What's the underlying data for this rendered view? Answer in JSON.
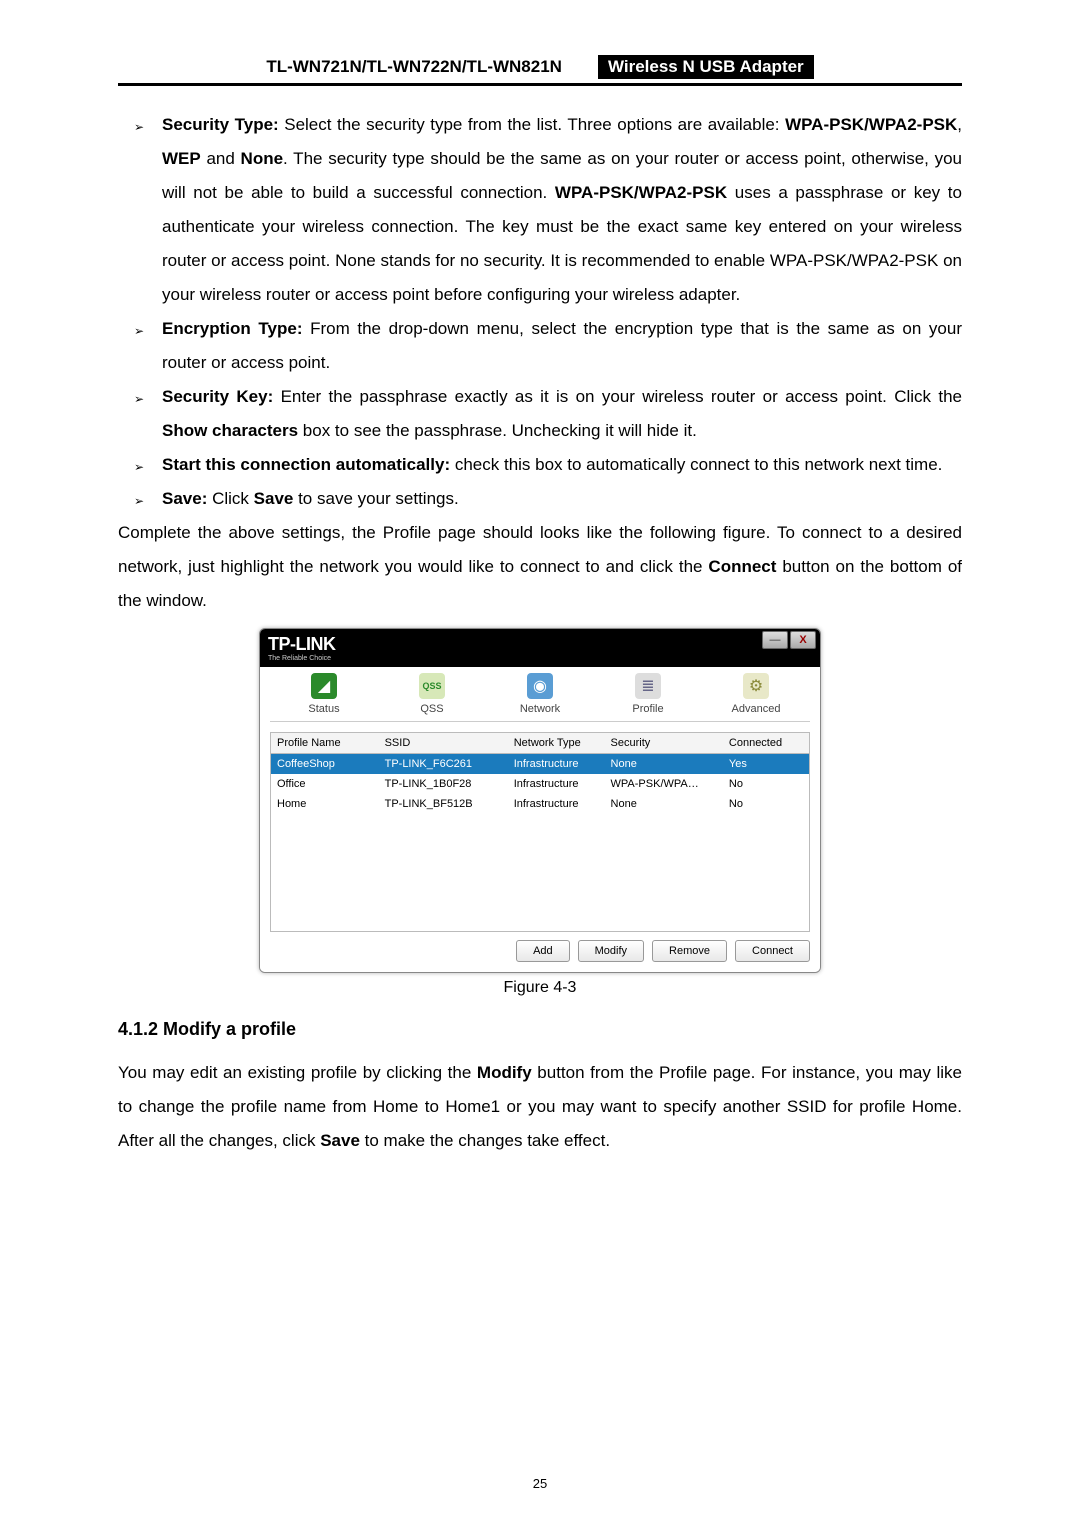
{
  "header": {
    "model": "TL-WN721N/TL-WN722N/TL-WN821N",
    "product": "Wireless N USB Adapter"
  },
  "bullets": {
    "security_type": {
      "label": "Security Type:",
      "text1": " Select the security type from the list. Three options are available: ",
      "bold1": "WPA-PSK/WPA2-PSK",
      "bold2": "WEP",
      "bold3": "None",
      "text2": ". The security type should be the same as on your router or access point, otherwise, you will not be able to build a successful connection. ",
      "bold4": "WPA-PSK/WPA2-PSK",
      "text3": " uses a passphrase or key to authenticate your wireless connection. The key must be the exact same key entered on your wireless router or access point. None stands for no security. It is recommended to enable WPA-PSK/WPA2-PSK on your wireless router or access point before configuring your wireless adapter."
    },
    "encryption_type": {
      "label": "Encryption Type:",
      "text": " From the drop-down menu, select the encryption type that is the same as on your router or access point."
    },
    "security_key": {
      "label": "Security Key:",
      "text1": " Enter the passphrase exactly as it is on your wireless router or access point. Click the ",
      "bold1": "Show characters",
      "text2": " box to see the passphrase. Unchecking it will hide it."
    },
    "start_conn": {
      "label": "Start this connection automatically:",
      "text": " check this box to automatically connect to this network next time."
    },
    "save": {
      "label": "Save:",
      "text1": " Click ",
      "bold1": "Save",
      "text2": " to save your settings."
    }
  },
  "paragraph1": {
    "text1": "Complete the above settings, the Profile page should looks like the following figure. To connect to a desired network, just highlight the network you would like to connect to and click the ",
    "bold1": "Connect",
    "text2": " button on the bottom of the window."
  },
  "app": {
    "logo": "TP-LINK",
    "logo_sub": "The Reliable Choice",
    "tabs": {
      "status": "Status",
      "qss": "QSS",
      "network": "Network",
      "profile": "Profile",
      "advanced": "Advanced"
    },
    "table": {
      "headers": {
        "name": "Profile Name",
        "ssid": "SSID",
        "type": "Network Type",
        "security": "Security",
        "connected": "Connected"
      },
      "rows": [
        {
          "name": "CoffeeShop",
          "ssid": "TP-LINK_F6C261",
          "type": "Infrastructure",
          "security": "None",
          "connected": "Yes",
          "selected": true
        },
        {
          "name": "Office",
          "ssid": "TP-LINK_1B0F28",
          "type": "Infrastructure",
          "security": "WPA-PSK/WPA…",
          "connected": "No",
          "selected": false
        },
        {
          "name": "Home",
          "ssid": "TP-LINK_BF512B",
          "type": "Infrastructure",
          "security": "None",
          "connected": "No",
          "selected": false
        }
      ]
    },
    "buttons": {
      "add": "Add",
      "modify": "Modify",
      "remove": "Remove",
      "connect": "Connect"
    }
  },
  "figure_caption": "Figure 4-3",
  "section_heading": "4.1.2  Modify a profile",
  "paragraph2": {
    "text1": "You may edit an existing profile by clicking the ",
    "bold1": "Modify",
    "text2": " button from the Profile page. For instance, you may like to change the profile name from Home to Home1 or you may want to specify another SSID for profile Home. After all the changes, click ",
    "bold2": "Save",
    "text3": " to make the changes take effect."
  },
  "page_number": "25"
}
